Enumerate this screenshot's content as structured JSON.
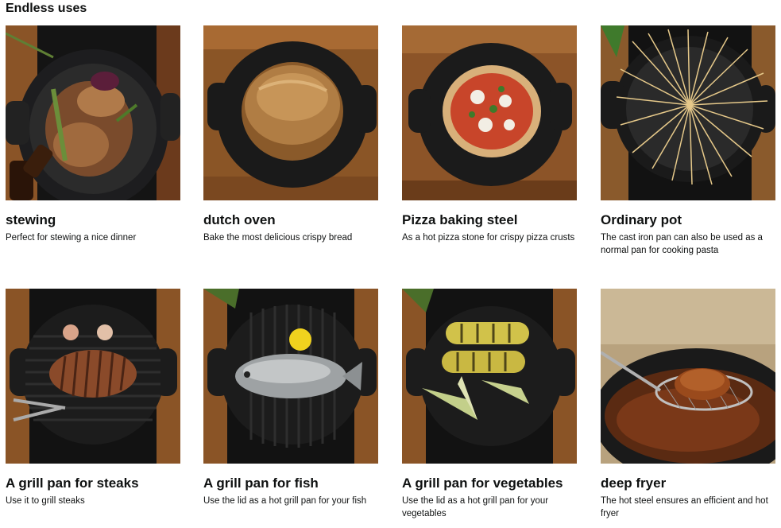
{
  "section": {
    "heading": "Endless uses"
  },
  "cards": [
    {
      "image": "stew-in-cast-iron-pan",
      "title": "stewing",
      "description": "Perfect for stewing a nice dinner"
    },
    {
      "image": "bread-loaf-on-pan",
      "title": "dutch oven",
      "description": "Bake the most delicious crispy bread"
    },
    {
      "image": "pizza-on-baking-steel",
      "title": "Pizza baking steel",
      "description": "As a hot pizza stone for crispy pizza crusts"
    },
    {
      "image": "spaghetti-in-pot",
      "title": "Ordinary pot",
      "description": "The cast iron pan can also be used as a normal pan for cooking pasta"
    },
    {
      "image": "steak-on-grill-pan",
      "title": "A grill pan for steaks",
      "description": "Use it to grill steaks"
    },
    {
      "image": "fish-on-grill-pan",
      "title": "A grill pan for fish",
      "description": "Use the lid as a hot grill pan for your fish"
    },
    {
      "image": "vegetables-on-grill-pan",
      "title": "A grill pan for vegetables",
      "description": "Use the lid as a hot grill pan for your vegetables"
    },
    {
      "image": "deep-fried-food-in-basket",
      "title": "deep fryer",
      "description": "The hot steel ensures an efficient and hot fryer"
    }
  ]
}
